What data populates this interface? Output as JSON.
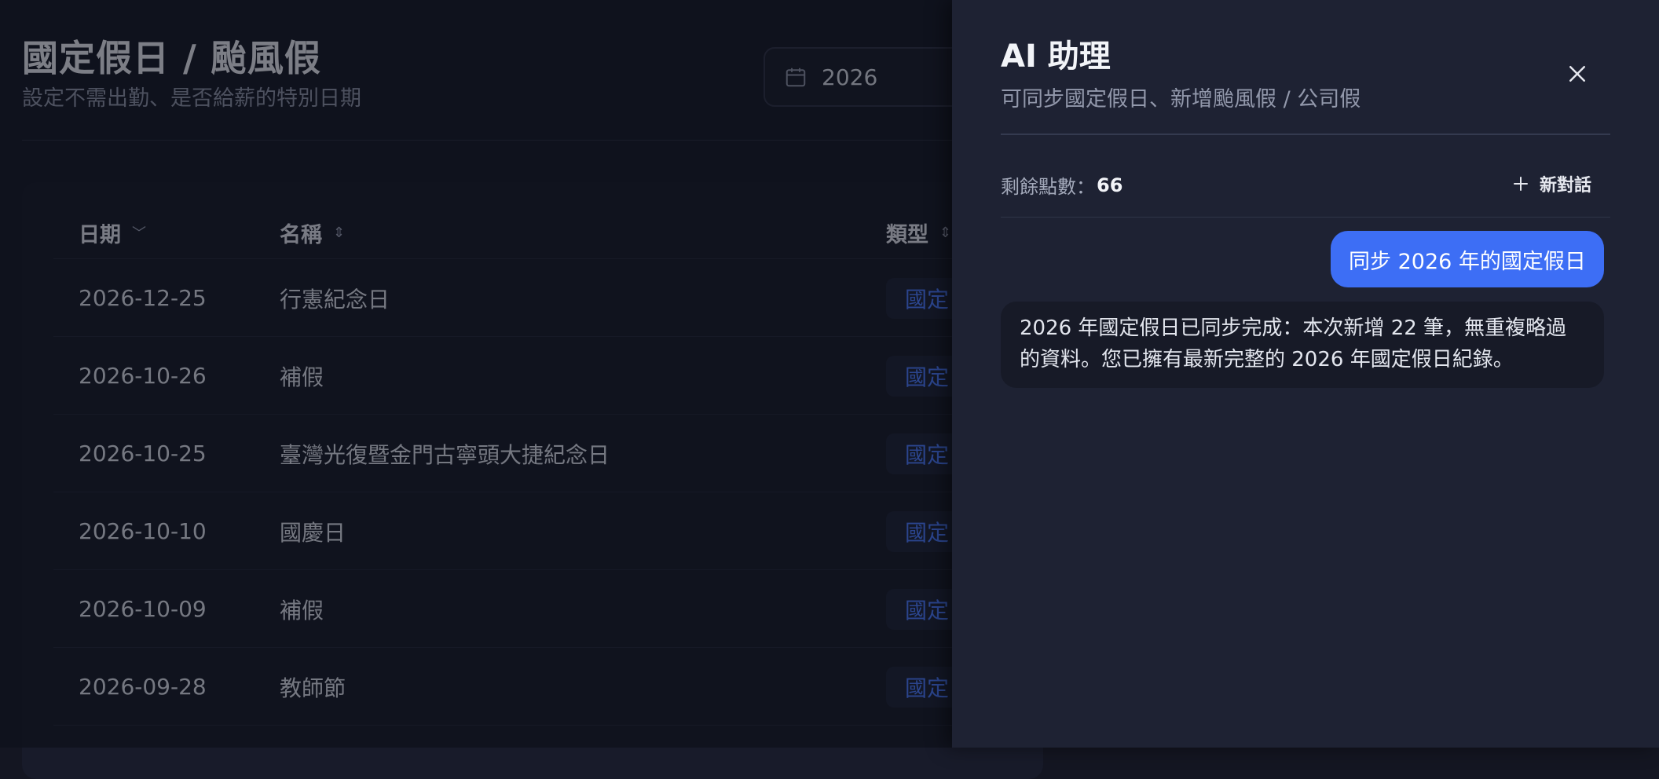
{
  "page": {
    "title": "國定假日 / 颱風假",
    "subtitle": "設定不需出勤、是否給薪的特別日期",
    "year_filter": {
      "value": "2026",
      "icon": "calendar-icon"
    }
  },
  "table": {
    "columns": [
      {
        "label": "日期",
        "sort": "chevron-down-icon"
      },
      {
        "label": "名稱",
        "sort": "sort-icon"
      },
      {
        "label": "類型",
        "sort": "sort-icon"
      }
    ],
    "rows": [
      {
        "date": "2026-12-25",
        "name": "行憲紀念日",
        "type": "國定"
      },
      {
        "date": "2026-10-26",
        "name": "補假",
        "type": "國定"
      },
      {
        "date": "2026-10-25",
        "name": "臺灣光復暨金門古寧頭大捷紀念日",
        "type": "國定"
      },
      {
        "date": "2026-10-10",
        "name": "國慶日",
        "type": "國定"
      },
      {
        "date": "2026-10-09",
        "name": "補假",
        "type": "國定"
      },
      {
        "date": "2026-09-28",
        "name": "教師節",
        "type": "國定"
      }
    ]
  },
  "assistant": {
    "title": "AI 助理",
    "subtitle": "可同步國定假日、新增颱風假 / 公司假",
    "credits_label": "剩餘點數：",
    "credits_value": "66",
    "new_chat_label": "新對話",
    "messages": [
      {
        "role": "user",
        "text": "同步 2026 年的國定假日"
      },
      {
        "role": "assistant",
        "text": "2026 年國定假日已同步完成：本次新增 22 筆，無重複略過的資料。您已擁有最新完整的 2026 年國定假日紀錄。"
      }
    ]
  },
  "colors": {
    "accent": "#3d6ef5",
    "badge_text": "#4b7cff",
    "drawer_bg": "#1e2233"
  }
}
